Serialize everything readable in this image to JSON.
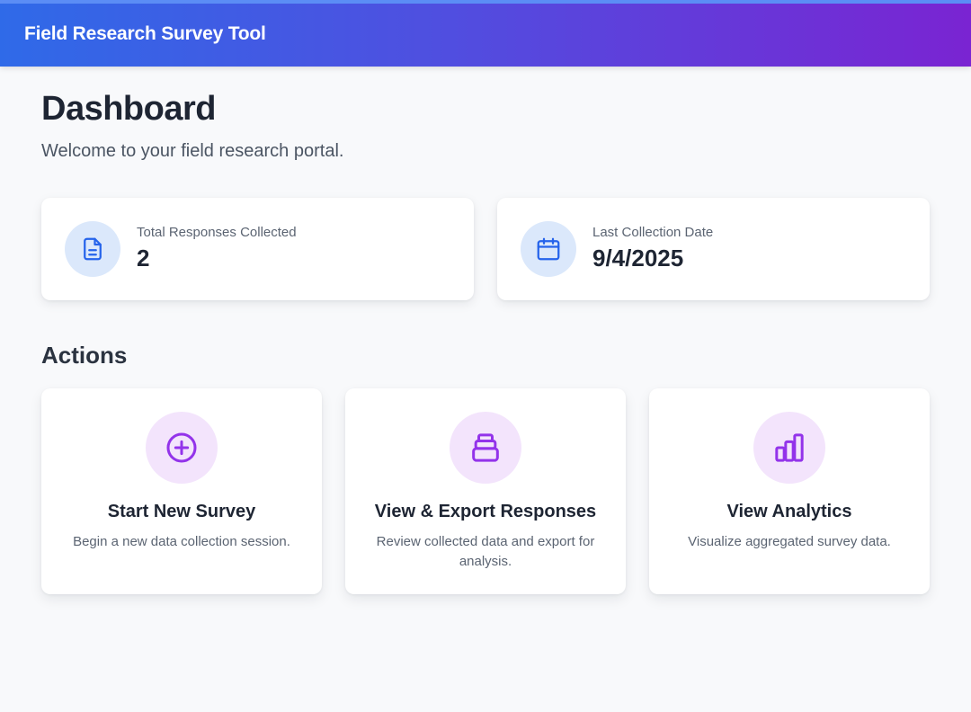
{
  "app": {
    "title": "Field Research Survey Tool"
  },
  "page": {
    "title": "Dashboard",
    "subtitle": "Welcome to your field research portal."
  },
  "stats": [
    {
      "label": "Total Responses Collected",
      "value": "2",
      "icon": "document-icon"
    },
    {
      "label": "Last Collection Date",
      "value": "9/4/2025",
      "icon": "calendar-icon"
    }
  ],
  "actions_section": {
    "title": "Actions"
  },
  "actions": [
    {
      "title": "Start New Survey",
      "description": "Begin a new data collection session.",
      "icon": "plus-circle-icon"
    },
    {
      "title": "View & Export Responses",
      "description": "Review collected data and export for analysis.",
      "icon": "database-icon"
    },
    {
      "title": "View Analytics",
      "description": "Visualize aggregated survey data.",
      "icon": "bar-chart-icon"
    }
  ],
  "colors": {
    "header_gradient_start": "#2f6ae8",
    "header_gradient_end": "#7a24d2",
    "stat_icon_bg": "#dbe8fb",
    "stat_icon_fg": "#2563eb",
    "action_icon_bg": "#f3e4fc",
    "action_icon_fg": "#9333ea"
  }
}
